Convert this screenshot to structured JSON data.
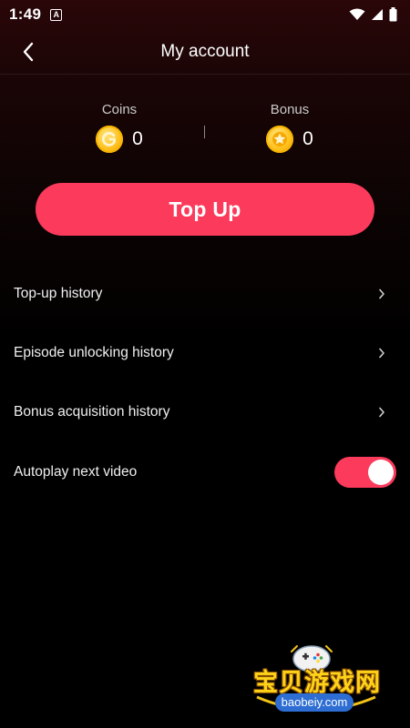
{
  "status_bar": {
    "time": "1:49",
    "notification_glyph": "A",
    "icons": [
      "wifi-icon",
      "signal-icon",
      "battery-icon"
    ]
  },
  "header": {
    "title": "My account",
    "back_icon": "chevron-left-icon"
  },
  "balances": {
    "coins": {
      "label": "Coins",
      "value": "0",
      "icon": "coin-icon"
    },
    "bonus": {
      "label": "Bonus",
      "value": "0",
      "icon": "star-coin-icon"
    }
  },
  "topup": {
    "label": "Top Up"
  },
  "menu": [
    {
      "label": "Top-up history",
      "icon": "chevron-right-icon"
    },
    {
      "label": "Episode unlocking history",
      "icon": "chevron-right-icon"
    },
    {
      "label": "Bonus acquisition history",
      "icon": "chevron-right-icon"
    }
  ],
  "autoplay": {
    "label": "Autoplay next video",
    "enabled": true
  },
  "watermark": {
    "text": "宝贝游戏网",
    "url": "baobeiy.com"
  },
  "colors": {
    "accent": "#fb3a5c",
    "coin": "#ffc21f",
    "background": "#000000",
    "header_tint": "#2a0608"
  }
}
